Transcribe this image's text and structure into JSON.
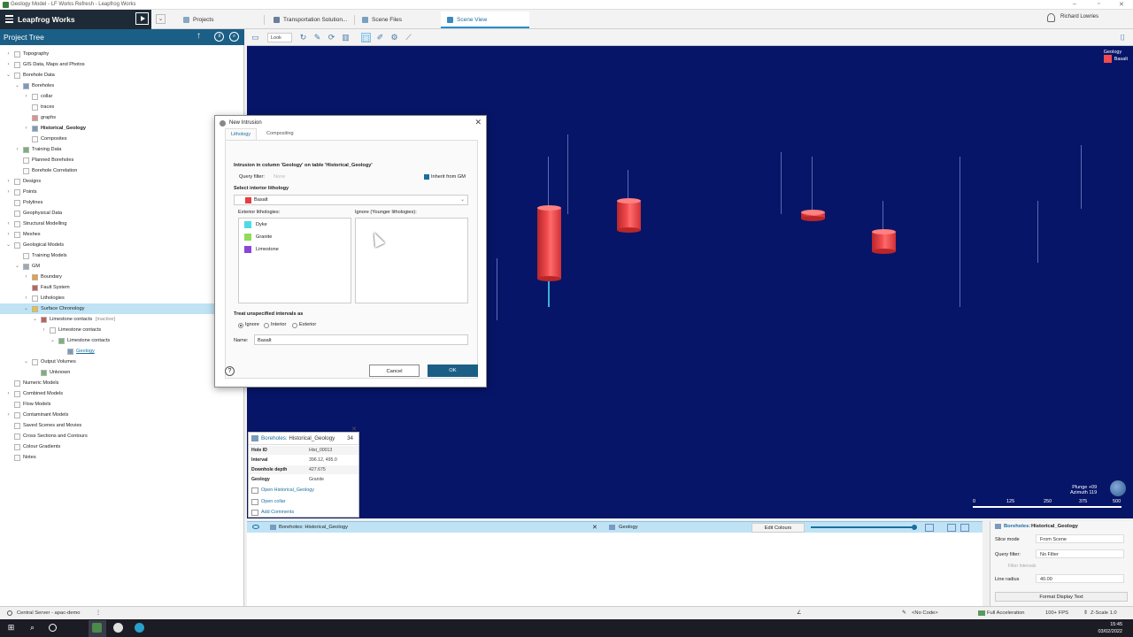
{
  "window": {
    "title": "Geology Model - LF Works Refresh - Leapfrog Works"
  },
  "brand": {
    "label": "Leapfrog Works"
  },
  "tabs": [
    {
      "label": "Projects"
    },
    {
      "label": "Transportation Solution..."
    },
    {
      "label": "Scene Files"
    },
    {
      "label": "Scene View"
    }
  ],
  "user": {
    "name": "Richard Lowries"
  },
  "project_tree": {
    "title": "Project Tree",
    "rows": [
      "Topography",
      "GIS Data, Maps and Photos",
      "Borehole Data",
      "Boreholes",
      "collar",
      "traces",
      "graphs",
      "Historical_Geology",
      "Composites",
      "Training Data",
      "Planned Boreholes",
      "Borehole Correlation",
      "Designs",
      "Points",
      "Polylines",
      "Geophysical Data",
      "Structural Modelling",
      "Meshes",
      "Geological Models",
      "Training Models",
      "GM",
      "Boundary",
      "Fault System",
      "Lithologies",
      "Surface Chronology",
      "Limestone contacts",
      "[inactive]",
      "Limestone contacts",
      "Limestone contacts",
      "Geology",
      "Output Volumes",
      "Unknown",
      "Numeric Models",
      "Combined Models",
      "Flow Models",
      "Contaminant Models",
      "Saved Scenes and Movies",
      "Cross Sections and Contours",
      "Colour Gradients",
      "Notes"
    ]
  },
  "viewer": {
    "look_label": "Look",
    "legend_title": "Geology",
    "legend_item": "Basalt",
    "legend_color": "#f04a4e",
    "plunge": "Plunge +09",
    "azimuth": "Azimuth 119",
    "scale_ticks": [
      "0",
      "125",
      "250",
      "375",
      "500"
    ]
  },
  "dialog": {
    "title": "New Intrusion",
    "tabs": [
      "Lithology",
      "Compositing"
    ],
    "heading": "Intrusion in column 'Geology' on table 'Historical_Geology'",
    "query_filter_label": "Query filter:",
    "query_filter_value": "None",
    "inherit_label": "Inherit from GM",
    "select_interior_label": "Select interior lithology",
    "interior_value": "Basalt",
    "interior_color": "#e0403f",
    "exterior_label": "Exterior lithologies:",
    "ignore_label": "Ignore (Younger lithologies):",
    "exterior_items": [
      {
        "name": "Dyke",
        "color": "#4dd9e8"
      },
      {
        "name": "Granite",
        "color": "#8fdc5a"
      },
      {
        "name": "Limestone",
        "color": "#8a46d9"
      }
    ],
    "treat_label": "Treat unspecified intervals as",
    "radio_options": [
      "Ignore",
      "Interior",
      "Exterior"
    ],
    "name_label": "Name:",
    "name_value": "Basalt",
    "cancel_label": "Cancel",
    "ok_label": "OK",
    "help_label": "?"
  },
  "info_popup": {
    "title_prefix": "Boreholes:",
    "title": "Historical_Geology",
    "count": "34",
    "rows": [
      {
        "key": "Hole ID",
        "value": "Hist_00013"
      },
      {
        "key": "Interval",
        "value": "396.12, 495.0"
      },
      {
        "key": "Downhole depth",
        "value": "427.675"
      },
      {
        "key": "Geology",
        "value": "Granite"
      }
    ],
    "links": [
      "Open Historical_Geology",
      "Open collar",
      "Add Comments"
    ]
  },
  "shape_list": {
    "item": "Boreholes: Historical_Geology",
    "column": "Geology",
    "edit_colours": "Edit Colours"
  },
  "properties": {
    "title_prefix": "Boreholes:",
    "title": "Historical_Geology",
    "slice_mode_label": "Slice mode",
    "slice_mode_value": "From Scene",
    "query_filter_label": "Query filter:",
    "query_filter_value": "No Filter",
    "filter_hint": "Filter Intervals",
    "line_radius_label": "Line radius",
    "line_radius_value": "40.00",
    "format_button": "Format Display Text"
  },
  "status": {
    "server": "Central Server - apac-demo",
    "code": "<No Code>",
    "accel": "Full Acceleration",
    "fps": "100+ FPS",
    "zscale": "Z-Scale 1.0"
  },
  "taskbar": {
    "time": "15:45",
    "date": "03/02/2022"
  }
}
